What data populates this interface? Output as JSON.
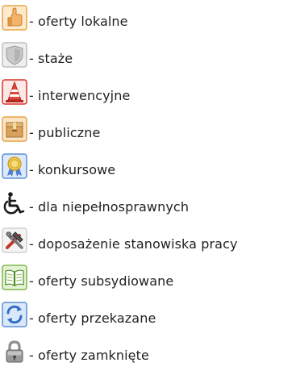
{
  "legend": {
    "items": [
      {
        "icon": "hand-pointing-icon",
        "label": "- oferty lokalne"
      },
      {
        "icon": "grey-shield-icon",
        "label": "- staże"
      },
      {
        "icon": "traffic-cone-icon",
        "label": "- interwencyjne"
      },
      {
        "icon": "cardboard-box-icon",
        "label": "- publiczne"
      },
      {
        "icon": "award-medal-icon",
        "label": "- konkursowe"
      },
      {
        "icon": "wheelchair-icon",
        "label": "- dla niepełnosprawnych"
      },
      {
        "icon": "hammer-wrench-icon",
        "label": "- doposażenie stanowiska pracy"
      },
      {
        "icon": "green-book-icon",
        "label": "- oferty subsydiowane"
      },
      {
        "icon": "blue-refresh-arrows-icon",
        "label": "- oferty przekazane"
      },
      {
        "icon": "padlock-icon",
        "label": "- oferty zamknięte"
      }
    ]
  },
  "colors": {
    "text": "#1f1f1f",
    "orange_frame": "#e8a447",
    "blue_frame": "#5b8fd6",
    "green_frame": "#7fb74a",
    "cone_red": "#d9342b",
    "box_brown": "#d8a25c",
    "lock_grey": "#8f8f8f"
  }
}
